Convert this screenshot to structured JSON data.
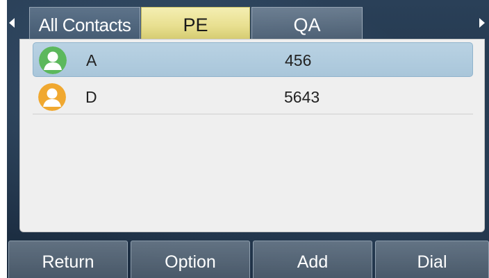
{
  "tabs": {
    "all_contacts": "All Contacts",
    "pe": "PE",
    "qa": "QA",
    "active": "PE"
  },
  "contacts": [
    {
      "name": "A",
      "number": "456",
      "avatar_color": "#5cb85c",
      "selected": true
    },
    {
      "name": "D",
      "number": "5643",
      "avatar_color": "#f0a830",
      "selected": false
    }
  ],
  "softkeys": {
    "return": "Return",
    "option": "Option",
    "add": "Add",
    "dial": "Dial"
  },
  "icons": {
    "left_arrow": "triangle-left-icon",
    "right_arrow": "triangle-right-icon",
    "contact_avatar": "person-avatar-icon"
  },
  "colors": {
    "active_tab": "#e8df8f",
    "selected_row": "#b9d2e3"
  }
}
